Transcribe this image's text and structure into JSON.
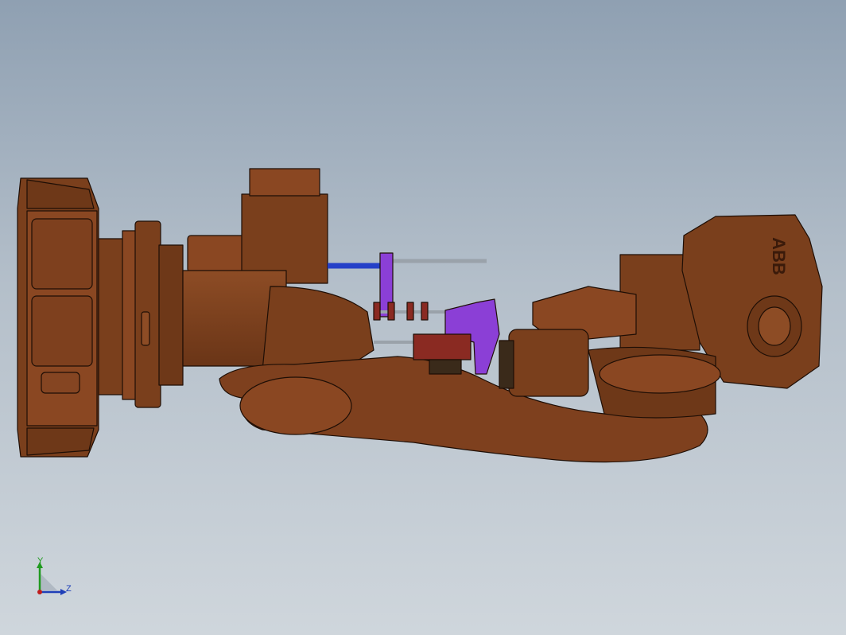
{
  "viewport": {
    "background_top": "#8fa0b2",
    "background_bottom": "#cfd6dc"
  },
  "model": {
    "brand_label": "ABB",
    "colors": {
      "robot_body": "#7a3f1c",
      "robot_body_light": "#8d4c25",
      "robot_body_dark": "#5a2c12",
      "outline": "#1e0e05",
      "gripper_purple": "#8b3fd6",
      "cylinder_blue": "#2540c8",
      "rod_gray": "#9aa2aa",
      "clamp_red": "#8a2a22"
    }
  },
  "triad": {
    "y_label": "Y",
    "z_label": "Z",
    "colors": {
      "y": "#1f9a1f",
      "z": "#1f3fb8",
      "x": "#c01c1c"
    }
  }
}
